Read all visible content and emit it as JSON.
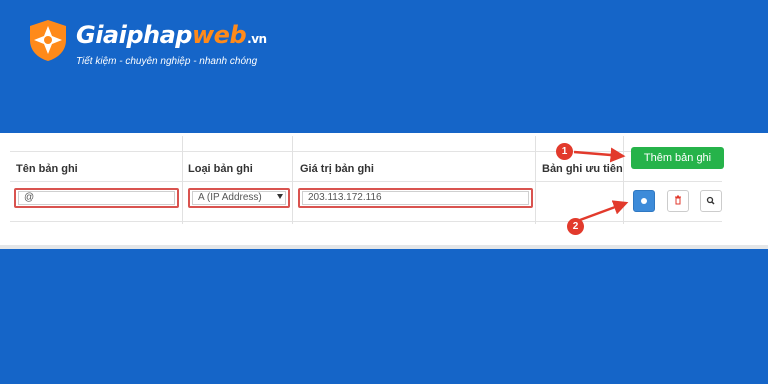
{
  "brand": {
    "name_prefix": "Giaiphap",
    "name_highlight": "web",
    "tld": ".vn",
    "slogan": "Tiết kiệm - chuyên nghiệp - nhanh chóng",
    "accent_color": "#ff8a1a"
  },
  "dns_table": {
    "columns": [
      "Tên bản ghi",
      "Loại bản ghi",
      "Giá trị bản ghi",
      "Bản ghi ưu tiên"
    ],
    "record": {
      "name": "@",
      "type": "A (IP Address)",
      "value": "203.113.172.116"
    },
    "add_button_label": "Thêm bản ghi",
    "action_icons": [
      "save-icon",
      "trash-icon",
      "search-icon"
    ]
  },
  "annotations": {
    "step1": "1",
    "step2": "2"
  },
  "colors": {
    "background": "#1565c8",
    "add_button": "#26b34a",
    "save_button": "#3d8bd9",
    "marker": "#e23a2c",
    "field_highlight": "#d9534f"
  }
}
